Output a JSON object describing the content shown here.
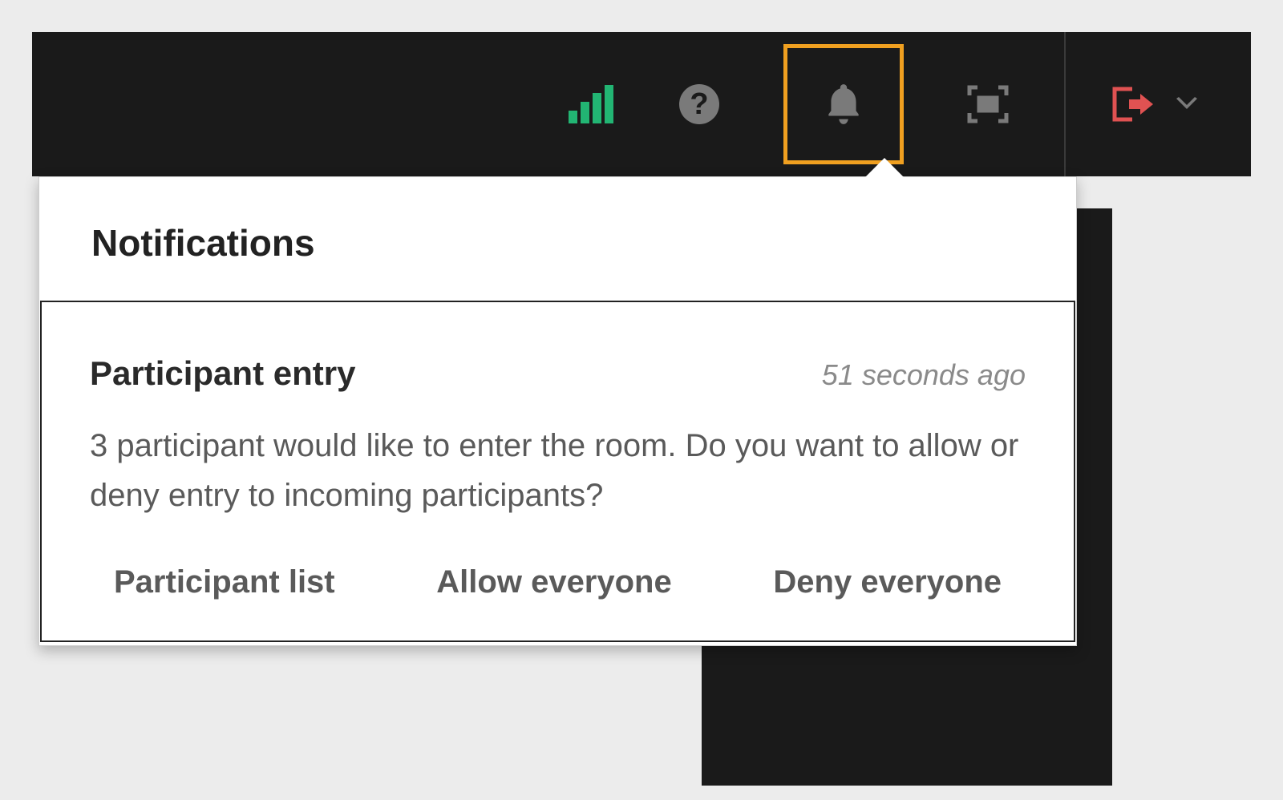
{
  "toolbar": {
    "icons": {
      "signal": "signal-icon",
      "help": "help-icon",
      "bell": "bell-icon",
      "fullscreen": "fullscreen-icon",
      "exit": "exit-icon",
      "chevron": "chevron-down-icon"
    },
    "help_symbol": "?"
  },
  "notifications": {
    "header": "Notifications",
    "items": [
      {
        "title": "Participant entry",
        "timestamp": "51 seconds ago",
        "body": "3 participant would like to enter the room. Do you want to allow or deny entry to incoming participants?",
        "actions": {
          "participant_list": "Participant list",
          "allow_everyone": "Allow everyone",
          "deny_everyone": "Deny everyone"
        }
      }
    ]
  },
  "colors": {
    "highlight": "#f0a020",
    "accent_green": "#22b573",
    "accent_red": "#e05252",
    "toolbar_bg": "#1a1a1a"
  }
}
